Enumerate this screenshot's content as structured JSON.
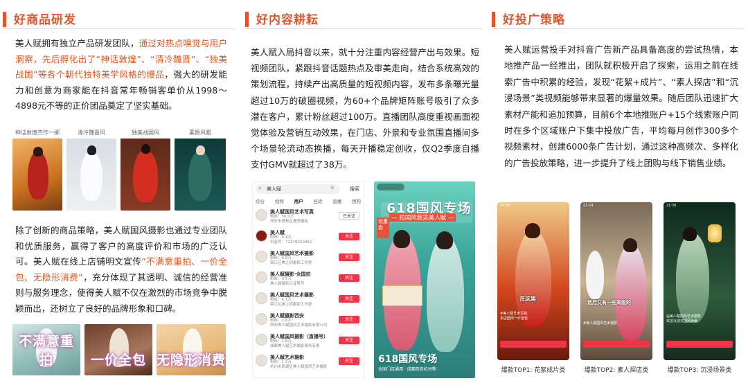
{
  "colors": {
    "accent": "#e4542b",
    "highlight": "#e2541c",
    "follow": "#f0354a"
  },
  "col1": {
    "title": "好商品研发",
    "p1": [
      {
        "t": "美人赋拥有独立产品研发团队，"
      },
      {
        "t": "通过对热点嗅觉与用户洞察，先后孵化出了“神话敦煌”、“清冷魏晋”、“独美战国”等各个朝代独特美学风格的爆品",
        "hl": true
      },
      {
        "t": "，强大的研发能力和创意为商家能在抖音常年畅销客单价从1998～4898元不等的正价团品奠定了坚实基础。"
      }
    ],
    "photo_captions": [
      "神话敦煌杰作一掷",
      "清冷魏晋风",
      "独美战国风",
      "素颜风雅"
    ],
    "photo_brand": "美人赋",
    "p2": [
      {
        "t": "除了创新的商品策略，美人赋国风摄影也通过专业团队和优质服务，赢得了客户的高度评价和市场的广泛认可。美人赋在线上店铺明文宣传"
      },
      {
        "t": "“不满意重拍、一价全包、无隐形消费”",
        "hl": true
      },
      {
        "t": "，充分体现了其透明、诚信的经营准则与服务理念，使得美人赋不仅在激烈的市场竞争中脱颖而出，还树立了良好的品牌形象和口碑。"
      }
    ],
    "banners": [
      "不满意重拍",
      "一价全包",
      "无隐形消费"
    ]
  },
  "col2": {
    "title": "好内容耕耘",
    "p1": "美人赋入局抖音以来，就十分注重内容经营产出与效果。短视频团队，紧跟抖音话题热点及审美走向，结合系统高效的策划流程，持续产出高质量的短视频内容，发布多条曝光量超过10万的破圈视频，为60+个品牌矩阵账号吸引了众多潜在客户，累计粉丝超过100万。直播团队高度重视画面视觉体验及营销互动效果，在门店、外景和专业氛围直播间多个场景轮流动态换播，每天开播稳定创收，仅Q2季度自播支付GMV就超过了38万。",
    "search": {
      "query": "美人赋",
      "button": "搜索",
      "tabs": [
        "综合",
        "视频",
        "用户",
        "经验",
        "直播",
        "团购"
      ],
      "active_tab": "用户"
    },
    "accounts": [
      {
        "name": "美人赋国风艺术写真",
        "sub": "粉丝：56.0万\n西安市碑林区德贤摄影",
        "btn": "已关注",
        "done": true
      },
      {
        "name": "美人赋",
        "sub": "粉丝：9.4万\n抖音号：72278029452",
        "btn": "关注"
      },
      {
        "name": "美人赋国风艺术摄影",
        "sub": "粉丝：9.8万\n锦江区美之初摄影工作室",
        "btn": "关注"
      },
      {
        "name": "美人赋摄影·全国拍",
        "sub": "粉丝：9.5万\n美人赋摄影认证账号",
        "btn": "关注"
      },
      {
        "name": "美人赋国风艺术摄影",
        "sub": "粉丝：4.1万\n锦江区美之初摄影工作室",
        "btn": "关注"
      },
      {
        "name": "美人赋摄影西安",
        "sub": "粉丝：2.6万\n西安美人赋国风艺术摄影有限公司",
        "btn": "关注"
      },
      {
        "name": "美人赋国风摄影（直播号）",
        "sub": "粉丝：1.8万\n成都美人赋艺术摄影服务有限",
        "btn": "关注"
      },
      {
        "name": "美人赋艺术摄影",
        "sub": "粉丝：1.2万\n杭州市西湖区美人赋国风艺术摄影",
        "btn": "关注"
      }
    ],
    "poster": {
      "title": "618国风专场",
      "sub": "— 拍国风就选美人赋 —",
      "coupon": "优惠券",
      "bottom": "618国风专场",
      "bottom_sub": "全国门店通用 · 成都西安杭州等"
    }
  },
  "col3": {
    "title": "好投广策略",
    "p1": "美人赋运营投手对抖音广告新产品具备高度的尝试热情，本地推产品一经推出，团队就积极开启了探索，运用之前在线索广告中积累的经验，发现“花絮+成片”、“素人探店”和“沉浸场景”类视频能够带来显著的爆量效果。随后团队迅速扩大素材产能和追加预算，目前6个本地推账户+15个线索账户同时在多个区域账户下集中投放广告，平均每月创作300多个视频素材，创建6000条广告计划，通过这种高频次、多样化的广告投放策略，进一步提升了线上团购与线下销售业绩。",
    "videos": [
      {
        "overlay": "在这里",
        "caption": "爆款TOP1: 花絮成片类"
      },
      {
        "overlay": "您后又有一些高级的",
        "caption": "爆款TOP2: 素人探店类"
      },
      {
        "overlay": "",
        "caption": "爆款TOP3: 沉浸场景类"
      }
    ]
  }
}
